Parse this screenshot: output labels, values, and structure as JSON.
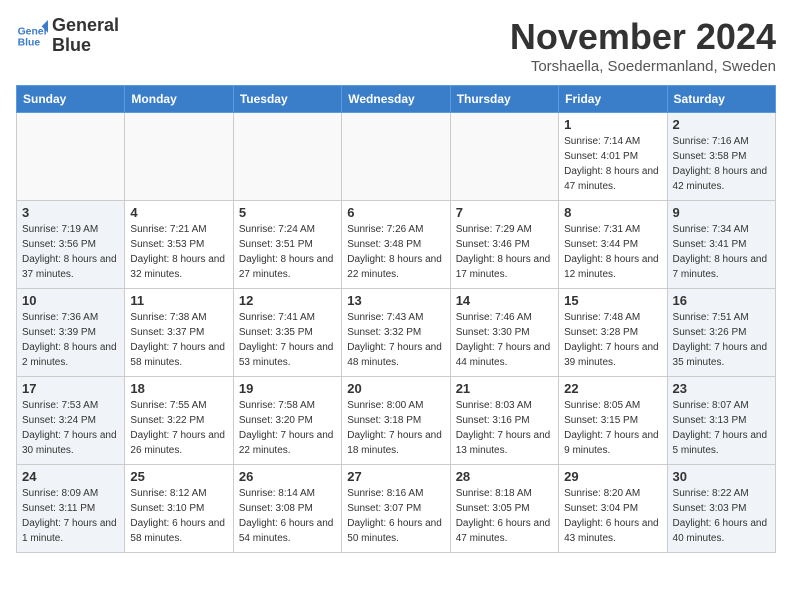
{
  "header": {
    "logo_line1": "General",
    "logo_line2": "Blue",
    "month": "November 2024",
    "location": "Torshaella, Soedermanland, Sweden"
  },
  "weekdays": [
    "Sunday",
    "Monday",
    "Tuesday",
    "Wednesday",
    "Thursday",
    "Friday",
    "Saturday"
  ],
  "weeks": [
    [
      {
        "day": "",
        "info": ""
      },
      {
        "day": "",
        "info": ""
      },
      {
        "day": "",
        "info": ""
      },
      {
        "day": "",
        "info": ""
      },
      {
        "day": "",
        "info": ""
      },
      {
        "day": "1",
        "info": "Sunrise: 7:14 AM\nSunset: 4:01 PM\nDaylight: 8 hours and 47 minutes."
      },
      {
        "day": "2",
        "info": "Sunrise: 7:16 AM\nSunset: 3:58 PM\nDaylight: 8 hours and 42 minutes."
      }
    ],
    [
      {
        "day": "3",
        "info": "Sunrise: 7:19 AM\nSunset: 3:56 PM\nDaylight: 8 hours and 37 minutes."
      },
      {
        "day": "4",
        "info": "Sunrise: 7:21 AM\nSunset: 3:53 PM\nDaylight: 8 hours and 32 minutes."
      },
      {
        "day": "5",
        "info": "Sunrise: 7:24 AM\nSunset: 3:51 PM\nDaylight: 8 hours and 27 minutes."
      },
      {
        "day": "6",
        "info": "Sunrise: 7:26 AM\nSunset: 3:48 PM\nDaylight: 8 hours and 22 minutes."
      },
      {
        "day": "7",
        "info": "Sunrise: 7:29 AM\nSunset: 3:46 PM\nDaylight: 8 hours and 17 minutes."
      },
      {
        "day": "8",
        "info": "Sunrise: 7:31 AM\nSunset: 3:44 PM\nDaylight: 8 hours and 12 minutes."
      },
      {
        "day": "9",
        "info": "Sunrise: 7:34 AM\nSunset: 3:41 PM\nDaylight: 8 hours and 7 minutes."
      }
    ],
    [
      {
        "day": "10",
        "info": "Sunrise: 7:36 AM\nSunset: 3:39 PM\nDaylight: 8 hours and 2 minutes."
      },
      {
        "day": "11",
        "info": "Sunrise: 7:38 AM\nSunset: 3:37 PM\nDaylight: 7 hours and 58 minutes."
      },
      {
        "day": "12",
        "info": "Sunrise: 7:41 AM\nSunset: 3:35 PM\nDaylight: 7 hours and 53 minutes."
      },
      {
        "day": "13",
        "info": "Sunrise: 7:43 AM\nSunset: 3:32 PM\nDaylight: 7 hours and 48 minutes."
      },
      {
        "day": "14",
        "info": "Sunrise: 7:46 AM\nSunset: 3:30 PM\nDaylight: 7 hours and 44 minutes."
      },
      {
        "day": "15",
        "info": "Sunrise: 7:48 AM\nSunset: 3:28 PM\nDaylight: 7 hours and 39 minutes."
      },
      {
        "day": "16",
        "info": "Sunrise: 7:51 AM\nSunset: 3:26 PM\nDaylight: 7 hours and 35 minutes."
      }
    ],
    [
      {
        "day": "17",
        "info": "Sunrise: 7:53 AM\nSunset: 3:24 PM\nDaylight: 7 hours and 30 minutes."
      },
      {
        "day": "18",
        "info": "Sunrise: 7:55 AM\nSunset: 3:22 PM\nDaylight: 7 hours and 26 minutes."
      },
      {
        "day": "19",
        "info": "Sunrise: 7:58 AM\nSunset: 3:20 PM\nDaylight: 7 hours and 22 minutes."
      },
      {
        "day": "20",
        "info": "Sunrise: 8:00 AM\nSunset: 3:18 PM\nDaylight: 7 hours and 18 minutes."
      },
      {
        "day": "21",
        "info": "Sunrise: 8:03 AM\nSunset: 3:16 PM\nDaylight: 7 hours and 13 minutes."
      },
      {
        "day": "22",
        "info": "Sunrise: 8:05 AM\nSunset: 3:15 PM\nDaylight: 7 hours and 9 minutes."
      },
      {
        "day": "23",
        "info": "Sunrise: 8:07 AM\nSunset: 3:13 PM\nDaylight: 7 hours and 5 minutes."
      }
    ],
    [
      {
        "day": "24",
        "info": "Sunrise: 8:09 AM\nSunset: 3:11 PM\nDaylight: 7 hours and 1 minute."
      },
      {
        "day": "25",
        "info": "Sunrise: 8:12 AM\nSunset: 3:10 PM\nDaylight: 6 hours and 58 minutes."
      },
      {
        "day": "26",
        "info": "Sunrise: 8:14 AM\nSunset: 3:08 PM\nDaylight: 6 hours and 54 minutes."
      },
      {
        "day": "27",
        "info": "Sunrise: 8:16 AM\nSunset: 3:07 PM\nDaylight: 6 hours and 50 minutes."
      },
      {
        "day": "28",
        "info": "Sunrise: 8:18 AM\nSunset: 3:05 PM\nDaylight: 6 hours and 47 minutes."
      },
      {
        "day": "29",
        "info": "Sunrise: 8:20 AM\nSunset: 3:04 PM\nDaylight: 6 hours and 43 minutes."
      },
      {
        "day": "30",
        "info": "Sunrise: 8:22 AM\nSunset: 3:03 PM\nDaylight: 6 hours and 40 minutes."
      }
    ]
  ]
}
